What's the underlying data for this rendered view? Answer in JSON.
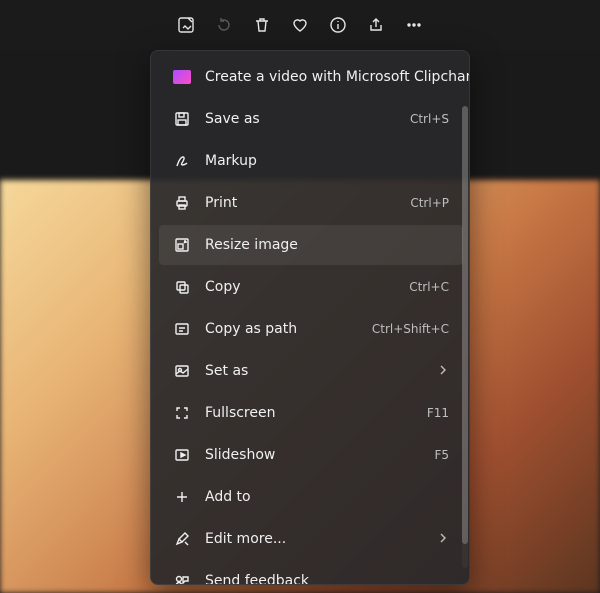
{
  "toolbar": {
    "items": [
      {
        "name": "edit-image-icon",
        "disabled": false
      },
      {
        "name": "rotate-icon",
        "disabled": true
      },
      {
        "name": "delete-icon",
        "disabled": false
      },
      {
        "name": "favorite-icon",
        "disabled": false
      },
      {
        "name": "info-icon",
        "disabled": false
      },
      {
        "name": "share-icon",
        "disabled": false
      },
      {
        "name": "more-icon",
        "disabled": false
      }
    ]
  },
  "menu": {
    "items": [
      {
        "icon": "clipchamp-icon",
        "label": "Create a video with Microsoft Clipchamp",
        "accel": "",
        "submenu": false
      },
      {
        "icon": "save-icon",
        "label": "Save as",
        "accel": "Ctrl+S",
        "submenu": false
      },
      {
        "icon": "markup-icon",
        "label": "Markup",
        "accel": "",
        "submenu": false
      },
      {
        "icon": "print-icon",
        "label": "Print",
        "accel": "Ctrl+P",
        "submenu": false
      },
      {
        "icon": "resize-icon",
        "label": "Resize image",
        "accel": "",
        "submenu": false,
        "hovered": true
      },
      {
        "icon": "copy-icon",
        "label": "Copy",
        "accel": "Ctrl+C",
        "submenu": false
      },
      {
        "icon": "copy-path-icon",
        "label": "Copy as path",
        "accel": "Ctrl+Shift+C",
        "submenu": false
      },
      {
        "icon": "set-as-icon",
        "label": "Set as",
        "accel": "",
        "submenu": true
      },
      {
        "icon": "fullscreen-icon",
        "label": "Fullscreen",
        "accel": "F11",
        "submenu": false
      },
      {
        "icon": "slideshow-icon",
        "label": "Slideshow",
        "accel": "F5",
        "submenu": false
      },
      {
        "icon": "add-icon",
        "label": "Add to",
        "accel": "",
        "submenu": false
      },
      {
        "icon": "edit-more-icon",
        "label": "Edit more...",
        "accel": "",
        "submenu": true
      },
      {
        "icon": "feedback-icon",
        "label": "Send feedback",
        "accel": "",
        "submenu": false
      }
    ]
  }
}
